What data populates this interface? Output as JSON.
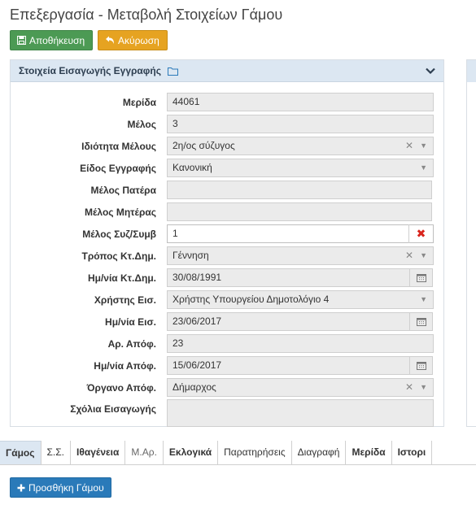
{
  "title": "Επεξεργασία - Μεταβολή Στοιχείων Γάμου",
  "toolbar": {
    "save_label": "Αποθήκευση",
    "cancel_label": "Ακύρωση"
  },
  "panel": {
    "title": "Στοιχεία Εισαγωγής Εγγραφής"
  },
  "fields": {
    "merida": {
      "label": "Μερίδα",
      "value": "44061"
    },
    "melos": {
      "label": "Μέλος",
      "value": "3"
    },
    "idiotita": {
      "label": "Ιδιότητα Μέλους",
      "value": "2η/ος σύζυγος"
    },
    "eidos": {
      "label": "Είδος Εγγραφής",
      "value": "Κανονική"
    },
    "pateras": {
      "label": "Μέλος Πατέρα",
      "value": ""
    },
    "miteras": {
      "label": "Μέλος Μητέρας",
      "value": ""
    },
    "syzygos": {
      "label": "Μέλος Συζ/Συμβ",
      "value": "1"
    },
    "tropos": {
      "label": "Τρόπος Κτ.Δημ.",
      "value": "Γέννηση"
    },
    "hm_kt": {
      "label": "Ημ/νία Κτ.Δημ.",
      "value": "30/08/1991"
    },
    "xristis": {
      "label": "Χρήστης Εισ.",
      "value": "Χρήστης Υπουργείου Δημοτολόγιο 4"
    },
    "hm_eis": {
      "label": "Ημ/νία Εισ.",
      "value": "23/06/2017"
    },
    "ar_apof": {
      "label": "Αρ. Απόφ.",
      "value": "23"
    },
    "hm_apof": {
      "label": "Ημ/νία Απόφ.",
      "value": "15/06/2017"
    },
    "organo": {
      "label": "Όργανο Απόφ.",
      "value": "Δήμαρχος"
    },
    "sxolia": {
      "label": "Σχόλια Εισαγωγής",
      "value": ""
    }
  },
  "tabs": [
    "Γάμος",
    "Σ.Σ.",
    "Ιθαγένεια",
    "Μ.Αρ.",
    "Εκλογικά",
    "Παρατηρήσεις",
    "Διαγραφή",
    "Μερίδα",
    "Ιστορι"
  ],
  "add_button": "Προσθήκη Γάμου",
  "colors": {
    "save": "#4c9a54",
    "cancel": "#e6a321",
    "primary": "#2a7ab9",
    "header_bg": "#dce7f2",
    "clear_red": "#d9251d"
  }
}
